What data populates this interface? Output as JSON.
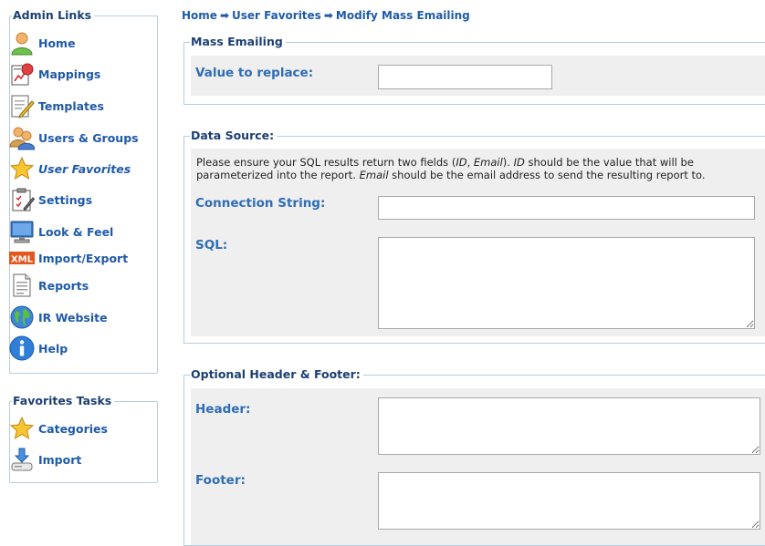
{
  "sidebar": {
    "admin_title": "Admin Links",
    "admin_items": [
      {
        "label": "Home",
        "icon": "user-icon"
      },
      {
        "label": "Mappings",
        "icon": "mappings-icon"
      },
      {
        "label": "Templates",
        "icon": "templates-icon"
      },
      {
        "label": "Users & Groups",
        "icon": "users-groups-icon"
      },
      {
        "label": "User Favorites",
        "icon": "star-icon",
        "active": true
      },
      {
        "label": "Settings",
        "icon": "settings-icon"
      },
      {
        "label": "Look & Feel",
        "icon": "monitor-icon"
      },
      {
        "label": "Import/Export",
        "icon": "xml-icon",
        "icon_text": "XML"
      },
      {
        "label": "Reports",
        "icon": "report-icon"
      },
      {
        "label": "IR Website",
        "icon": "globe-icon"
      },
      {
        "label": "Help",
        "icon": "info-icon"
      }
    ],
    "tasks_title": "Favorites Tasks",
    "task_items": [
      {
        "label": "Categories",
        "icon": "star-icon"
      },
      {
        "label": "Import",
        "icon": "import-icon"
      }
    ]
  },
  "breadcrumb": {
    "items": [
      "Home",
      "User Favorites",
      "Modify Mass Emailing"
    ],
    "separator": "➡"
  },
  "mass_emailing": {
    "legend": "Mass Emailing",
    "value_label": "Value to replace:",
    "value": ""
  },
  "data_source": {
    "legend": "Data Source:",
    "note_parts": {
      "p1": "Please ensure your SQL results return two fields (",
      "id": "ID",
      "p2": ", ",
      "email": "Email",
      "p3": "). ",
      "id2": "ID",
      "p4": " should be the value that will be parameterized into the report. ",
      "email2": "Email",
      "p5": " should be the email address to send the resulting report to."
    },
    "connection_label": "Connection String:",
    "connection_value": "",
    "sql_label": "SQL:",
    "sql_value": ""
  },
  "header_footer": {
    "legend": "Optional Header & Footer:",
    "header_label": "Header:",
    "header_value": "",
    "footer_label": "Footer:",
    "footer_value": ""
  },
  "colors": {
    "link": "#1f5aa8",
    "label": "#2f6db5",
    "border": "#b7cde0",
    "panel_bg": "#efefef"
  }
}
